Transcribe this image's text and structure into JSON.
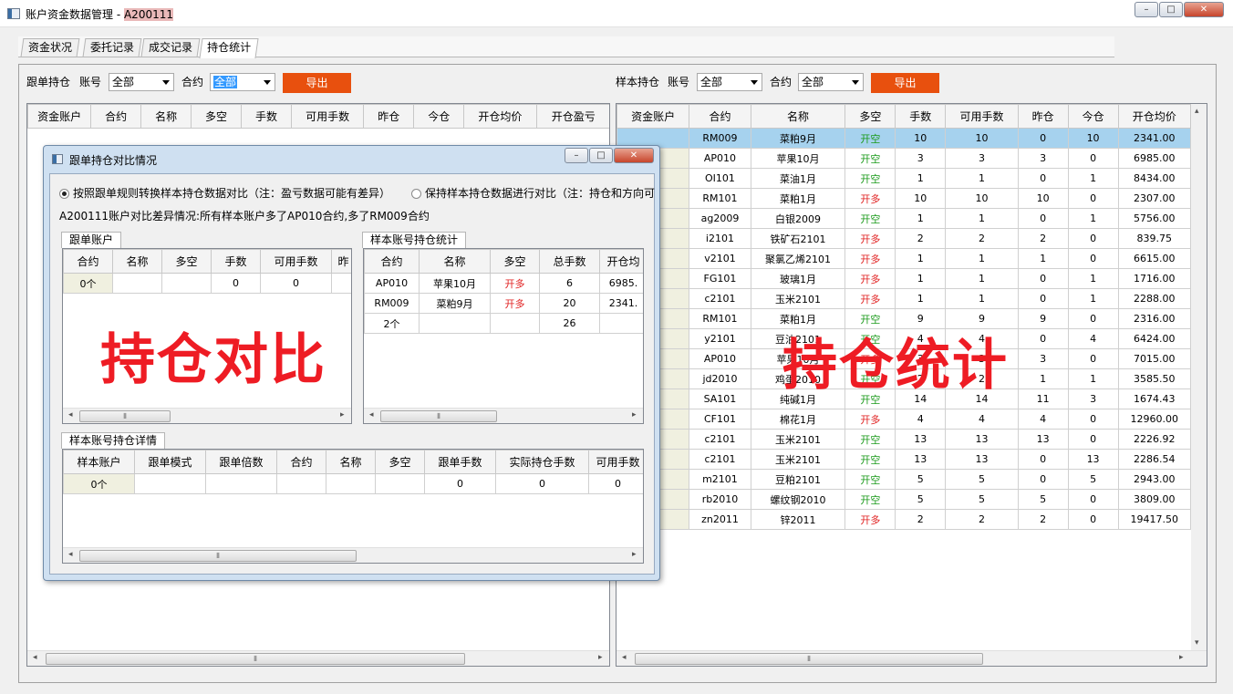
{
  "window": {
    "title": "账户资金数据管理 - ",
    "title_account": "A200111",
    "buttons": [
      "–",
      "□",
      "✕"
    ]
  },
  "tabs": [
    "资金状况",
    "委托记录",
    "成交记录",
    "持仓统计"
  ],
  "left_filter": {
    "section": "跟单持仓",
    "account_label": "账号",
    "account_value": "全部",
    "contract_label": "合约",
    "contract_value": "全部",
    "export": "导出"
  },
  "right_filter": {
    "section": "样本持仓",
    "account_label": "账号",
    "account_value": "全部",
    "contract_label": "合约",
    "contract_value": "全部",
    "export": "导出"
  },
  "left_table": {
    "columns": [
      "资金账户",
      "合约",
      "名称",
      "多空",
      "手数",
      "可用手数",
      "昨仓",
      "今仓",
      "开仓均价",
      "开仓盈亏"
    ]
  },
  "right_table": {
    "columns": [
      "资金账户",
      "合约",
      "名称",
      "多空",
      "手数",
      "可用手数",
      "昨仓",
      "今仓",
      "开仓均价"
    ],
    "rows": [
      [
        "RM009",
        "菜粕9月",
        "开空",
        "10",
        "10",
        "0",
        "10",
        "2341.00"
      ],
      [
        "AP010",
        "苹果10月",
        "开空",
        "3",
        "3",
        "3",
        "0",
        "6985.00"
      ],
      [
        "OI101",
        "菜油1月",
        "开空",
        "1",
        "1",
        "0",
        "1",
        "8434.00"
      ],
      [
        "RM101",
        "菜粕1月",
        "开多",
        "10",
        "10",
        "10",
        "0",
        "2307.00"
      ],
      [
        "ag2009",
        "白银2009",
        "开空",
        "1",
        "1",
        "0",
        "1",
        "5756.00"
      ],
      [
        "i2101",
        "铁矿石2101",
        "开多",
        "2",
        "2",
        "2",
        "0",
        "839.75"
      ],
      [
        "v2101",
        "聚氯乙烯2101",
        "开多",
        "1",
        "1",
        "1",
        "0",
        "6615.00"
      ],
      [
        "FG101",
        "玻璃1月",
        "开多",
        "1",
        "1",
        "0",
        "1",
        "1716.00"
      ],
      [
        "c2101",
        "玉米2101",
        "开多",
        "1",
        "1",
        "0",
        "1",
        "2288.00"
      ],
      [
        "RM101",
        "菜粕1月",
        "开空",
        "9",
        "9",
        "9",
        "0",
        "2316.00"
      ],
      [
        "y2101",
        "豆油2101",
        "开空",
        "4",
        "4",
        "0",
        "4",
        "6424.00"
      ],
      [
        "AP010",
        "苹果10月",
        "开多",
        "3",
        "3",
        "3",
        "0",
        "7015.00"
      ],
      [
        "jd2010",
        "鸡蛋2010",
        "开空",
        "2",
        "2",
        "1",
        "1",
        "3585.50"
      ],
      [
        "SA101",
        "纯碱1月",
        "开空",
        "14",
        "14",
        "11",
        "3",
        "1674.43"
      ],
      [
        "CF101",
        "棉花1月",
        "开多",
        "4",
        "4",
        "4",
        "0",
        "12960.00"
      ],
      [
        "c2101",
        "玉米2101",
        "开空",
        "13",
        "13",
        "13",
        "0",
        "2226.92"
      ],
      [
        "c2101",
        "玉米2101",
        "开空",
        "13",
        "13",
        "0",
        "13",
        "2286.54"
      ],
      [
        "m2101",
        "豆粕2101",
        "开空",
        "5",
        "5",
        "0",
        "5",
        "2943.00"
      ],
      [
        "rb2010",
        "螺纹钢2010",
        "开空",
        "5",
        "5",
        "5",
        "0",
        "3809.00"
      ],
      [
        "zn2011",
        "锌2011",
        "开多",
        "2",
        "2",
        "2",
        "0",
        "19417.50"
      ]
    ]
  },
  "dialog": {
    "title": "跟单持仓对比情况",
    "radio1": "按照跟单规则转换样本持仓数据对比（注：盈亏数据可能有差异）",
    "radio2": "保持样本持仓数据进行对比（注：持仓和方向可",
    "summary": "A200111账户对比差异情况:所有样本账户多了AP010合约,多了RM009合约",
    "follow_group": "跟单账户",
    "follow_columns": [
      "合约",
      "名称",
      "多空",
      "手数",
      "可用手数",
      "昨"
    ],
    "follow_rows": [
      [
        "0个",
        "",
        "",
        "0",
        "0",
        ""
      ]
    ],
    "sample_group": "样本账号持仓统计",
    "sample_columns": [
      "合约",
      "名称",
      "多空",
      "总手数",
      "开仓均"
    ],
    "sample_rows": [
      [
        "AP010",
        "苹果10月",
        "开多",
        "6",
        "6985."
      ],
      [
        "RM009",
        "菜粕9月",
        "开多",
        "20",
        "2341."
      ],
      [
        "2个",
        "",
        "",
        "26",
        ""
      ]
    ],
    "detail_group": "样本账号持仓详情",
    "detail_columns": [
      "样本账户",
      "跟单模式",
      "跟单倍数",
      "合约",
      "名称",
      "多空",
      "跟单手数",
      "实际持仓手数",
      "可用手数"
    ],
    "detail_rows": [
      [
        "0个",
        "",
        "",
        "",
        "",
        "",
        "0",
        "0",
        "0"
      ]
    ]
  },
  "watermarks": {
    "left": "持仓对比",
    "right": "持仓统计"
  },
  "colors": {
    "long": "#e02020",
    "short": "#1a9a1a",
    "export": "#e8500e",
    "selected_row": "#a6d2ee"
  }
}
